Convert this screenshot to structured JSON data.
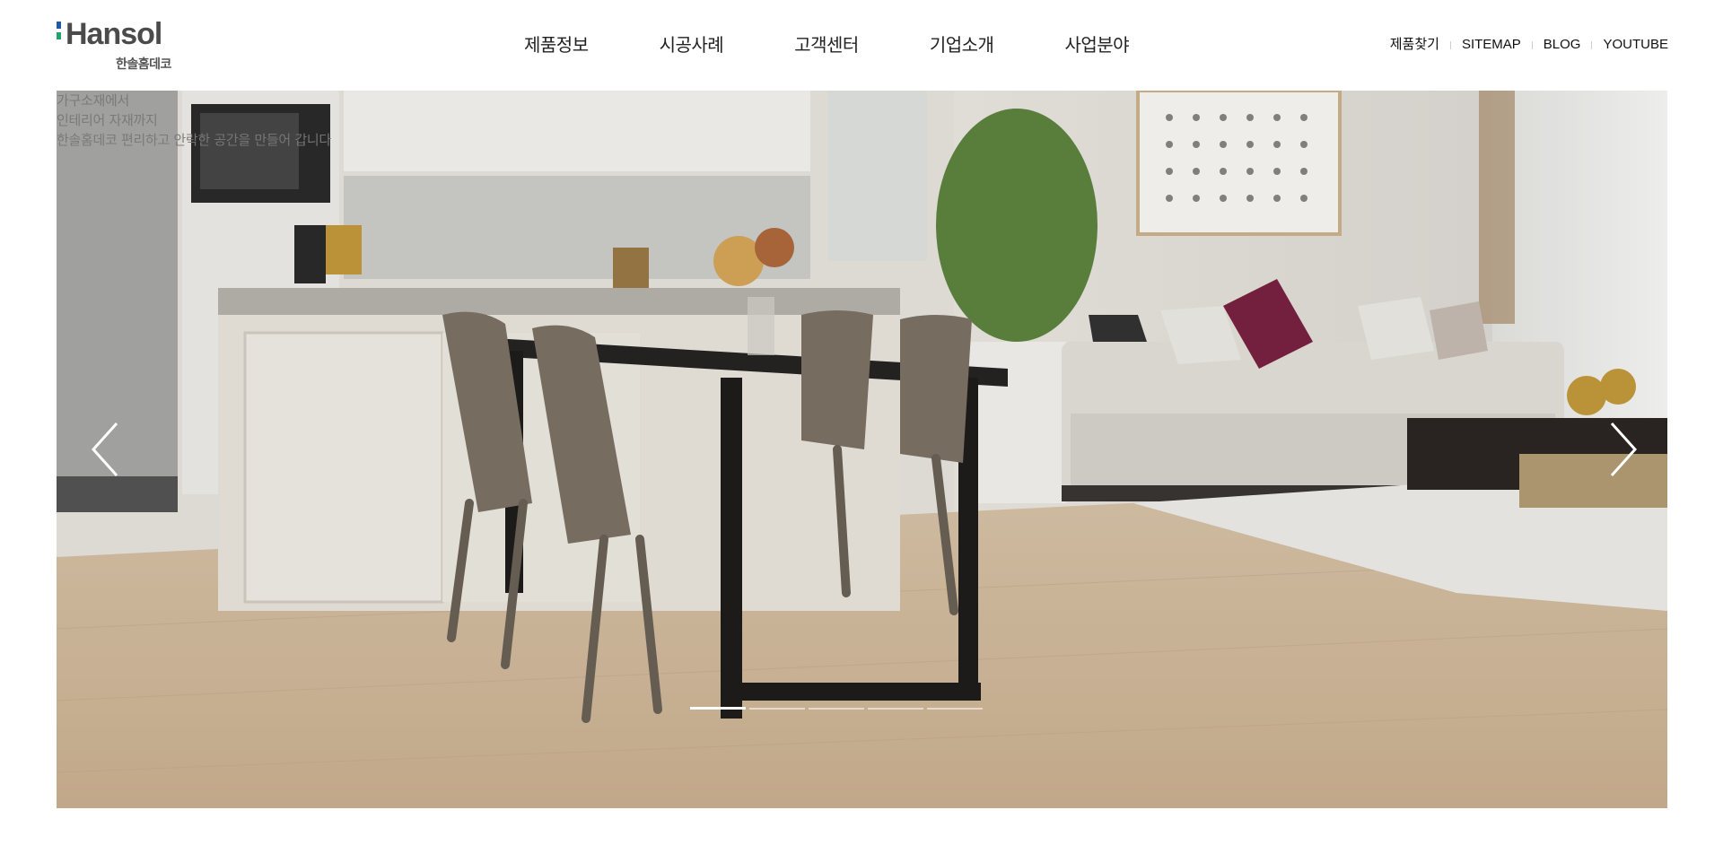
{
  "brand": {
    "logo_text": "Hansol",
    "logo_subtext": "한솔홈데코"
  },
  "nav": {
    "items": [
      {
        "label": "제품정보"
      },
      {
        "label": "시공사례"
      },
      {
        "label": "고객센터"
      },
      {
        "label": "기업소개"
      },
      {
        "label": "사업분야"
      }
    ]
  },
  "util_links": [
    {
      "label": "제품찾기"
    },
    {
      "label": "SITEMAP"
    },
    {
      "label": "BLOG"
    },
    {
      "label": "YOUTUBE"
    }
  ],
  "hero": {
    "tagline": [
      "가구소재에서",
      "인테리어 자재까지",
      "한솔홈데코 편리하고 안락한 공간을 만들어 갑니다"
    ],
    "prev_icon": "chevron-left-icon",
    "next_icon": "chevron-right-icon",
    "slide_count": 5,
    "active_slide": 1
  },
  "colors": {
    "logo_blue": "#1f5aa6",
    "logo_green": "#25a36b",
    "logo_text": "#4b4b4b"
  }
}
